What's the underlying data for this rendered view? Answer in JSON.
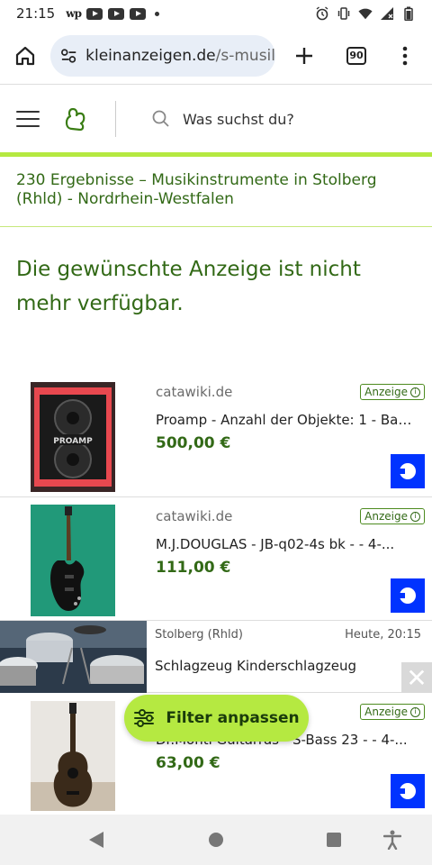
{
  "status_bar": {
    "time": "21:15",
    "notification_icons": [
      "washington-post-icon",
      "youtube-icon",
      "youtube-icon",
      "youtube-icon",
      "dot-icon"
    ],
    "system_icons": [
      "alarm-icon",
      "vibrate-icon",
      "wifi-icon",
      "signal-icon",
      "battery-icon"
    ]
  },
  "browser": {
    "url_host": "kleinanzeigen.de",
    "url_path": "/s-musil",
    "tab_count": "90"
  },
  "site_header": {
    "search_placeholder": "Was suchst du?"
  },
  "results": {
    "heading": "230 Ergebnisse – Musikinstrumente in Stolberg (Rhld) - Nordrhein-Westfalen",
    "unavailable_message": "Die gewünschte Anzeige ist nicht mehr verfügbar."
  },
  "listings": [
    {
      "source": "catawiki.de",
      "badge": "Anzeige",
      "title": "Proamp - Anzahl der Objekte: 1 - Bass-...",
      "price": "500,00 €",
      "image_text": "PROAMP"
    },
    {
      "source": "catawiki.de",
      "badge": "Anzeige",
      "title": "M.J.DOUGLAS - JB-q02-4s bk - - 4-...",
      "price": "111,00 €"
    },
    {
      "location": "Stolberg (Rhld)",
      "time": "Heute, 20:15",
      "title": "Schlagzeug Kinderschlagzeug"
    },
    {
      "badge": "Anzeige",
      "title": "Dr.Monti Guitarras - S-Bass 23 - - 4-...",
      "price": "63,00 €"
    }
  ],
  "filter_button": {
    "label": "Filter anpassen"
  },
  "colors": {
    "brand_green": "#326916",
    "accent_lime": "#b5e941",
    "catawiki_blue": "#0033ff"
  }
}
